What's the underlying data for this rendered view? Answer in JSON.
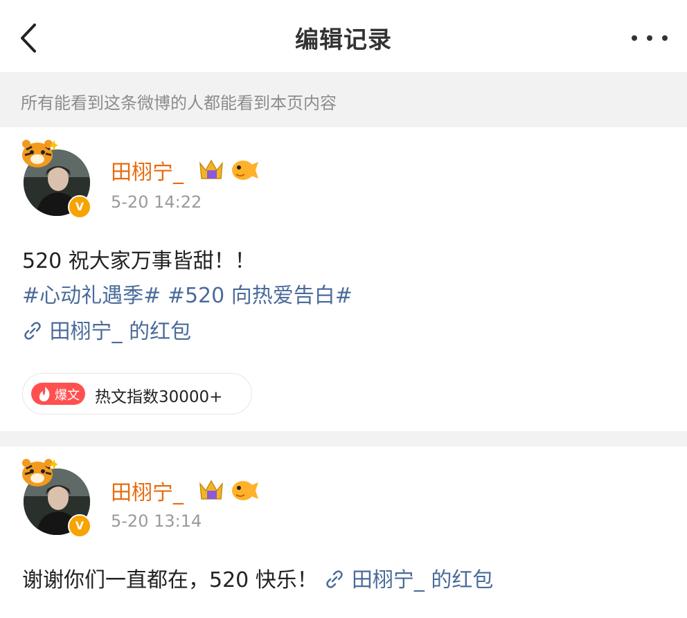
{
  "header": {
    "title": "编辑记录"
  },
  "notice": "所有能看到这条微博的人都能看到本页内容",
  "posts": [
    {
      "username": "田栩宁_",
      "time": "5-20 14:22",
      "text": "520 祝大家万事皆甜！！",
      "hashtags": [
        "#心动礼遇季#",
        "#520 向热爱告白#"
      ],
      "red_packet": "田栩宁_ 的红包",
      "hot": {
        "badge": "爆文",
        "label": "热文指数30000+"
      }
    },
    {
      "username": "田栩宁_",
      "time": "5-20 13:14",
      "text": "谢谢你们一直都在，520 快乐！",
      "red_packet": "田栩宁_ 的红包"
    }
  ],
  "verified_badge": "V",
  "icons": [
    "back-arrow-icon",
    "more-dots-icon",
    "crown-badge-icon",
    "pufferfish-badge-icon",
    "link-icon",
    "fire-icon"
  ],
  "colors": {
    "username": "#e86b0f",
    "link": "#4a6b9a",
    "hot": "#ff5050",
    "verified": "#f7a300"
  }
}
